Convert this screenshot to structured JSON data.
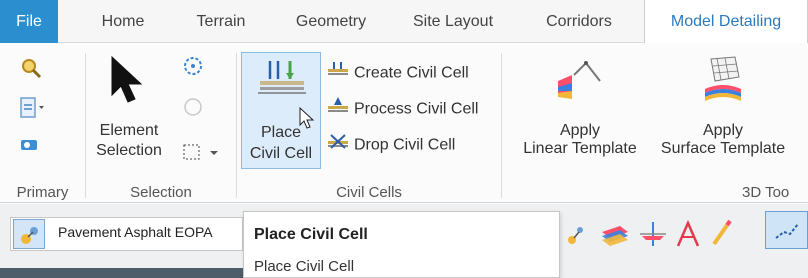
{
  "tabs": {
    "file": "File",
    "home": "Home",
    "terrain": "Terrain",
    "geometry": "Geometry",
    "site_layout": "Site Layout",
    "corridors": "Corridors",
    "model_detailing": "Model Detailing"
  },
  "groups": {
    "primary": "Primary",
    "selection": "Selection",
    "civil_cells": "Civil Cells",
    "tools_3d": "3D Too"
  },
  "selection": {
    "element_selection_line1": "Element",
    "element_selection_line2": "Selection"
  },
  "civil_cells": {
    "place_line1": "Place",
    "place_line2": "Civil Cell",
    "create": "Create Civil Cell",
    "process": "Process Civil Cell",
    "drop": "Drop Civil Cell"
  },
  "tools_3d": {
    "linear_line1": "Apply",
    "linear_line2": "Linear Template",
    "surface_line1": "Apply",
    "surface_line2": "Surface Template"
  },
  "lower_toolbar": {
    "feature_definition": "Pavement Asphalt EOPA"
  },
  "tooltip": {
    "title": "Place Civil Cell",
    "description": "Place Civil Cell"
  },
  "colors": {
    "file_tab": "#2b8fcf",
    "active_tab_text": "#2a7ac0",
    "highlight_fill": "#dcecfb",
    "highlight_border": "#8cbce6"
  }
}
